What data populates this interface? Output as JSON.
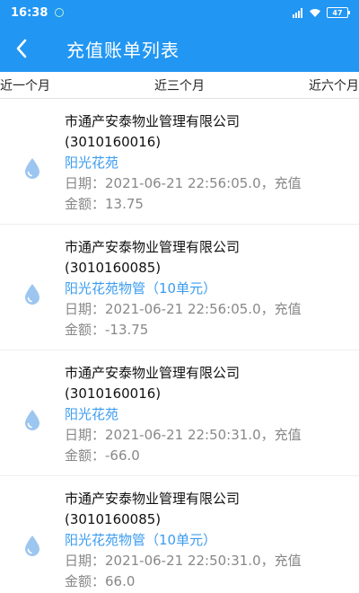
{
  "status_bar": {
    "time": "16:38",
    "battery": "47",
    "signal": "HD"
  },
  "app_bar": {
    "title": "充值账单列表",
    "back_icon": "chevron-left-icon"
  },
  "tabs": [
    {
      "label": "近一个月"
    },
    {
      "label": "近三个月"
    },
    {
      "label": "近六个月"
    }
  ],
  "records": [
    {
      "company": "市通产安泰物业管理有限公司",
      "account": "(3010160016)",
      "community": "阳光花苑",
      "date": "日期：2021-06-21 22:56:05.0，充值",
      "amount": "金额：13.75",
      "icon": "water-drop-icon"
    },
    {
      "company": "市通产安泰物业管理有限公司",
      "account": "(3010160085)",
      "community": "阳光花苑物管（10单元）",
      "date": "日期：2021-06-21 22:56:05.0，充值",
      "amount": "金额：-13.75",
      "icon": "water-drop-icon"
    },
    {
      "company": "市通产安泰物业管理有限公司",
      "account": "(3010160016)",
      "community": "阳光花苑",
      "date": "日期：2021-06-21 22:50:31.0，充值",
      "amount": "金额：-66.0",
      "icon": "water-drop-icon"
    },
    {
      "company": "市通产安泰物业管理有限公司",
      "account": "(3010160085)",
      "community": "阳光花苑物管（10单元）",
      "date": "日期：2021-06-21 22:50:31.0，充值",
      "amount": "金额：66.0",
      "icon": "water-drop-icon"
    }
  ],
  "colors": {
    "primary": "#2196f3",
    "link": "#3b9cf0",
    "meta_text": "#888888",
    "drop_icon": "#9cc6ef"
  }
}
